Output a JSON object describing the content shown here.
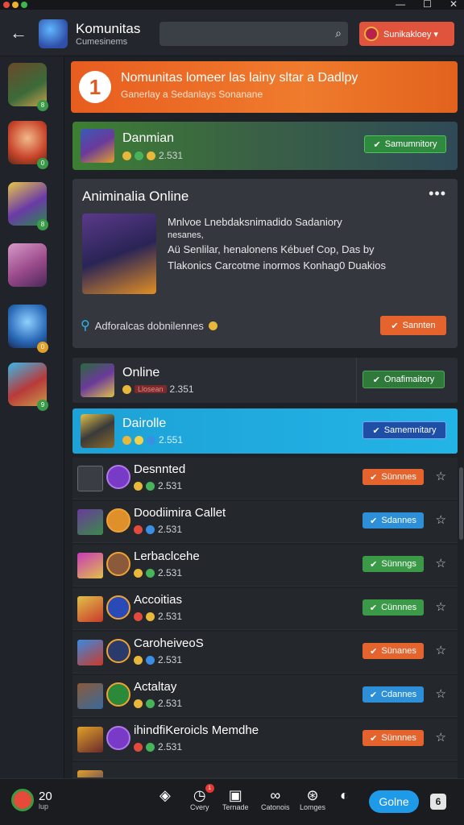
{
  "window": {
    "minimize": "—",
    "maximize": "☐",
    "close": "✕"
  },
  "header": {
    "title": "Komunitas",
    "subtitle": "Cumesinems",
    "search_placeholder": "",
    "action_label": "Sunikakloey ▾"
  },
  "sidebar": {
    "badges": [
      "8",
      "0",
      "8",
      "",
      "0",
      "9"
    ]
  },
  "banner": {
    "number": "1",
    "line1": "Nomunitas lomeer las lainy sltar a Dadlpy",
    "line2": "Ganerlay a Sedanlays Sonanane"
  },
  "featured_row": {
    "title": "Danmian",
    "meta": "2.531",
    "button": "Samumnitory"
  },
  "card": {
    "title": "Animinalia Online",
    "more": "•••",
    "lines": [
      "Mnlvoe Lnebdaksnimadido Sadaniory",
      "nesanes,",
      "Aü Senlilar, henalonens Kébuef Cop, Das by",
      "Tlakonics Carcotme inormos Konhag0 Duakios"
    ],
    "tag": "Adforalcas dobnilennes",
    "button": "Sannten"
  },
  "highlight_rows": [
    {
      "title": "Online",
      "meta": "2.351",
      "pill_label": "Onafimaitory",
      "chip": "Llosean"
    },
    {
      "title": "Dairolle",
      "meta": "2.551",
      "pill_label": "Samemnitary"
    }
  ],
  "list": [
    {
      "title": "Desnnted",
      "meta": "2.531",
      "pill": "Sünnnes"
    },
    {
      "title": "Doodiimira Callet",
      "meta": "2.531",
      "pill": "Sdannes"
    },
    {
      "title": "Lerbaclcehe",
      "meta": "2.531",
      "pill": "Sünnngs"
    },
    {
      "title": "Accoitias",
      "meta": "2.531",
      "pill": "Cünnnes"
    },
    {
      "title": "CaroheiveoS",
      "meta": "2.531",
      "pill": "Sünanes"
    },
    {
      "title": "Actaltay",
      "meta": "2.531",
      "pill": "Cdannes"
    },
    {
      "title": "ihindfiKeroicls Memdhe",
      "meta": "2.531",
      "pill": "Sünnnes"
    }
  ],
  "bottom": {
    "count": "20",
    "count_label": "lup",
    "items": [
      "",
      "Cvery",
      "Ternade",
      "Catonois",
      "Lomges",
      ""
    ],
    "notif": "1",
    "go": "Golne"
  },
  "colors": {
    "banner": "#e85d1f",
    "accent_blue": "#1f9ae8",
    "accent_green": "#3a9a48",
    "accent_orange": "#e5642d"
  }
}
